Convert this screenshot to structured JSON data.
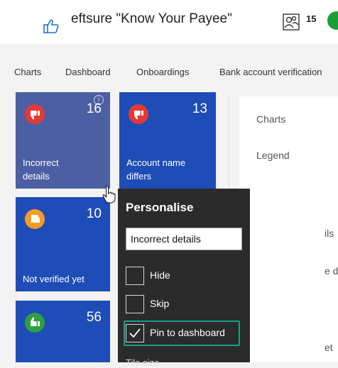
{
  "header": {
    "app_title": "eftsure \"Know Your Payee\"",
    "people_count": "15"
  },
  "tabs": [
    "Charts",
    "Dashboard",
    "Onboardings",
    "Bank account verification"
  ],
  "tiles": [
    {
      "count": "16",
      "label_line1": "Incorrect",
      "label_line2": "details",
      "icon": "thumbs-down-icon"
    },
    {
      "count": "13",
      "label_line1": "Account name",
      "label_line2": "differs",
      "icon": "thumbs-down-icon"
    },
    {
      "count": "10",
      "label_line1": "",
      "label_line2": "Not verified yet",
      "icon": "thumbs-sideways-icon"
    },
    {
      "count": "56",
      "icon": "thumbs-up-icon"
    }
  ],
  "side_panel": {
    "charts_label": "Charts",
    "legend_label": "Legend",
    "partial_1": "ils",
    "partial_2": "e d",
    "partial_3": "et"
  },
  "personalise": {
    "title": "Personalise",
    "name_value": "Incorrect details",
    "options": [
      {
        "label": "Hide",
        "checked": false
      },
      {
        "label": "Skip",
        "checked": false
      },
      {
        "label": "Pin to dashboard",
        "checked": true
      }
    ],
    "next_partial": "Tile size"
  },
  "colors": {
    "tile_blue": "#1e4db7",
    "tile_hover": "#4d5fa3",
    "popup_bg": "#2b2b2b",
    "highlight": "#16a085"
  }
}
